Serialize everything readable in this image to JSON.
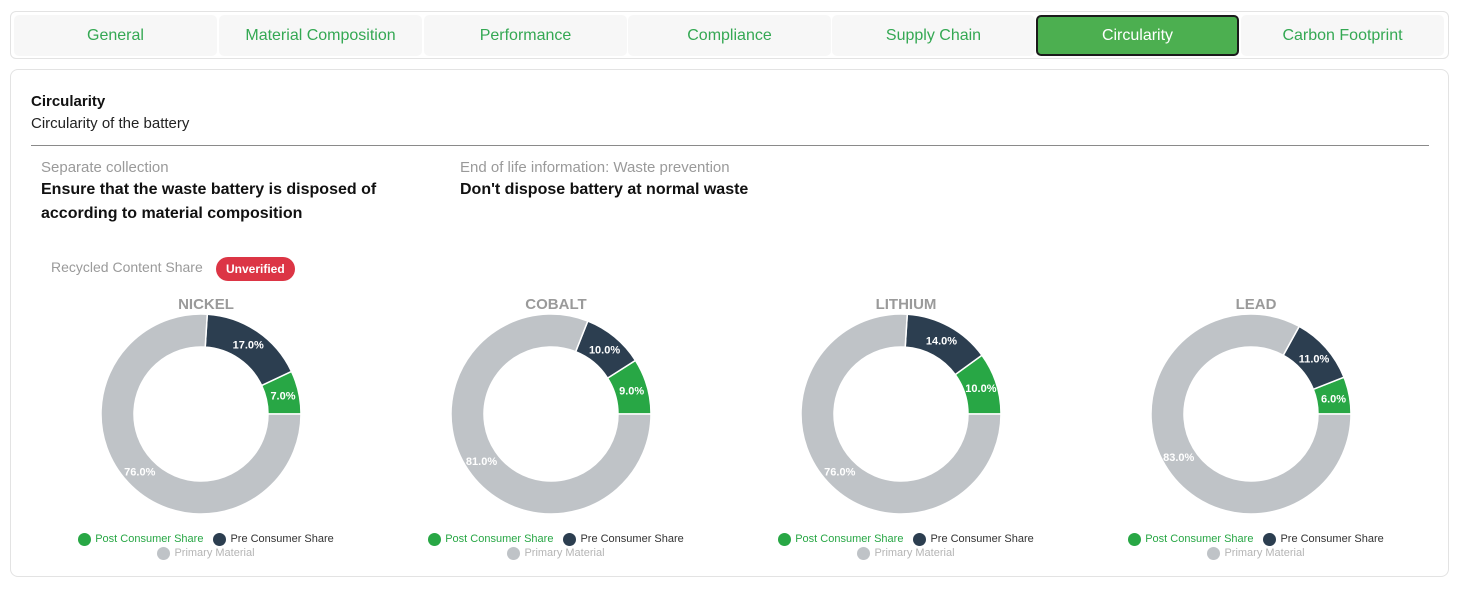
{
  "tabs": [
    {
      "label": "General",
      "active": false
    },
    {
      "label": "Material Composition",
      "active": false
    },
    {
      "label": "Performance",
      "active": false
    },
    {
      "label": "Compliance",
      "active": false
    },
    {
      "label": "Supply Chain",
      "active": false
    },
    {
      "label": "Circularity",
      "active": true
    },
    {
      "label": "Carbon Footprint",
      "active": false
    }
  ],
  "section": {
    "title": "Circularity",
    "subtitle": "Circularity of the battery"
  },
  "info": {
    "separate_collection": {
      "label": "Separate collection",
      "value": "Ensure that the waste battery is disposed of according to material composition"
    },
    "end_of_life": {
      "label": "End of life information: Waste prevention",
      "value": "Don't dispose battery at normal waste"
    }
  },
  "recycled": {
    "label": "Recycled Content Share",
    "badge": "Unverified"
  },
  "colors": {
    "post_consumer": "#28a745",
    "pre_consumer": "#2c3e50",
    "primary_material": "#bfc3c7",
    "badge": "#dc3545",
    "accent": "#4caf50"
  },
  "legend": {
    "post_consumer": "Post Consumer Share",
    "pre_consumer": "Pre Consumer Share",
    "primary_material": "Primary Material"
  },
  "chart_data": [
    {
      "type": "pie",
      "title": "NICKEL",
      "categories": [
        "Post Consumer Share",
        "Pre Consumer Share",
        "Primary Material"
      ],
      "values": [
        7.0,
        17.0,
        76.0
      ],
      "labels": [
        "7.0%",
        "17.0%",
        "76.0%"
      ]
    },
    {
      "type": "pie",
      "title": "COBALT",
      "categories": [
        "Post Consumer Share",
        "Pre Consumer Share",
        "Primary Material"
      ],
      "values": [
        9.0,
        10.0,
        81.0
      ],
      "labels": [
        "9.0%",
        "10.0%",
        "81.0%"
      ]
    },
    {
      "type": "pie",
      "title": "LITHIUM",
      "categories": [
        "Post Consumer Share",
        "Pre Consumer Share",
        "Primary Material"
      ],
      "values": [
        10.0,
        14.0,
        76.0
      ],
      "labels": [
        "10.0%",
        "14.0%",
        "76.0%"
      ]
    },
    {
      "type": "pie",
      "title": "LEAD",
      "categories": [
        "Post Consumer Share",
        "Pre Consumer Share",
        "Primary Material"
      ],
      "values": [
        6.0,
        11.0,
        83.0
      ],
      "labels": [
        "6.0%",
        "11.0%",
        "83.0%"
      ]
    }
  ]
}
